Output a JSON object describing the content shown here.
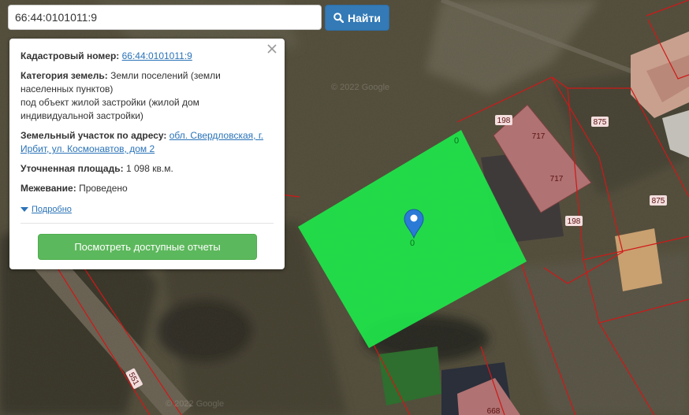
{
  "search": {
    "query": "66:44:0101011:9",
    "button_label": "Найти"
  },
  "info": {
    "cadastral_label": "Кадастровый номер:",
    "cadastral_value": "66:44:0101011:9",
    "category_label": "Категория земель:",
    "category_value_line1": "Земли поселений (земли",
    "category_value_line2": "населенных пунктов)",
    "category_value_line3": "под объект жилой застройки (жилой дом",
    "category_value_line4": "индивидуальной застройки)",
    "address_label": "Земельный участок по адресу:",
    "address_value_line1": "обл. Свердловская, г.",
    "address_value_line2": "Ирбит, ул. Космонавтов, дом 2",
    "area_label": "Уточненная площадь:",
    "area_value": "1 098 кв.м.",
    "survey_label": "Межевание:",
    "survey_value": "Проведено",
    "more_label": "Подробно",
    "reports_button": "Посмотреть доступные отчеты"
  },
  "map": {
    "parcel_numbers": [
      "198",
      "717",
      "717",
      "198",
      "875",
      "875",
      "551",
      "668"
    ],
    "watermarks": [
      "© 2022 Google",
      "© 2022 Google"
    ],
    "colors": {
      "selected_parcel": "#1ee64a",
      "boundary": "#d01818",
      "marker": "#2a7ad6",
      "building_roof": "#b07272"
    }
  }
}
